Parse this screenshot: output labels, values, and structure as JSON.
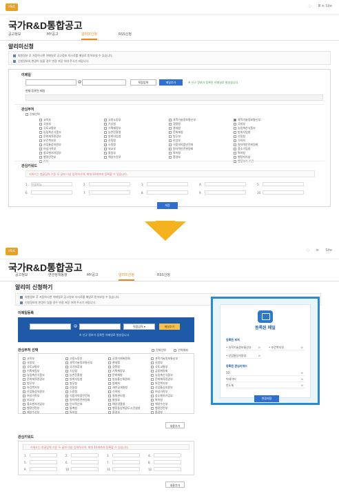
{
  "top": {
    "header": {
      "logo": "r&d",
      "icons": [
        "circle-icon",
        "hamburger-icon"
      ],
      "links": [
        "",
        "Ⅲ ≡ Site"
      ]
    },
    "page_title": "국가R&D통합공고",
    "tabs": [
      {
        "label": "공고정보",
        "active": false
      },
      {
        "label": "MY공고",
        "active": false
      },
      {
        "label": "알리미신청",
        "active": true
      },
      {
        "label": "RSS신청",
        "active": false
      }
    ],
    "section_title": "알리미신청",
    "notes": [
      "회원정보 후 저장하시면 이메일로 공고정보 자시로를 메일로 받아보실 수 있습니다.",
      "신청정보의 변경이 있을 경우 변경 저장 하여 주시기 바랍니다."
    ],
    "email": {
      "label": "이메일",
      "at": "@",
      "select_label": "직접입력",
      "add_button": "메일추가",
      "hint": "※ 신규 정보가 등록된 이메일로 발송됩니다.",
      "registered_label": "현재 등록된 메일"
    },
    "dept": {
      "label": "관심부처",
      "select_all": "전체선택",
      "columns": [
        [
          "교육부",
          "국방부",
          "국토교통부",
          "농림축산식품부",
          "문화체육관광부",
          "보건복지부",
          "산업통상자원부",
          "여성가족부",
          "중소벤처기업부",
          "행정안전부",
          "기타"
        ],
        [
          "고용노동부",
          "기상청",
          "기획재정부",
          "농촌진흥청",
          "방위사업청",
          "산림청",
          "소방청",
          "외교부",
          "통일부",
          "해양수산부"
        ],
        [
          "과학기술정보통신부",
          "경찰청",
          "관세청",
          "문화재청",
          "법무부",
          "산업부",
          "식품의약품안전처",
          "원자력안전위원회",
          "특허청",
          "환경부"
        ],
        [
          "과학기술정보통신부",
          "국방부",
          "농림축산식품부",
          "방위사업청",
          "산림청",
          "식약처",
          "원자력안전위원회",
          "중소기업청",
          "특허청",
          "행정자치부",
          "행정부처 기관"
        ]
      ],
      "checked": [
        [
          3,
          0
        ]
      ]
    },
    "keyword": {
      "label": "관심키워드",
      "note": "키워드는 한글입력 기준 두 글자 이상 입력하시며, 최대 10개까지 등록할 수 있습니다.",
      "labels": [
        "1.",
        "2.",
        "3.",
        "4.",
        "5.",
        "6.",
        "7.",
        "8.",
        "9.",
        "10."
      ],
      "first_value": "인공지능"
    },
    "save_button": "저장"
  },
  "bottom": {
    "header": {
      "logo": "r&d",
      "right": "Site"
    },
    "page_title": "국가R&D통합공고",
    "tabs": [
      {
        "label": "공고정보",
        "active": false
      },
      {
        "label": "연관정책동향",
        "active": false
      },
      {
        "label": "MY공고",
        "active": false
      },
      {
        "label": "알리미신청",
        "active": true
      },
      {
        "label": "RSS신청",
        "active": false
      }
    ],
    "section_title": "알리미 신청하기",
    "notes": [
      "회원정보 후 저장하시면 이메일로 공고정보 자시로를 메일로 받아보실 수 있습니다.",
      "신청정보의 변경이 있을 경우 변경 저장 하여 주시기 바랍니다."
    ],
    "email": {
      "label": "이메일등록",
      "at": "@",
      "select_label": "직접입력",
      "add_button": "메일추가",
      "hint": "※ 신규 정보가 등록된 이메일로 발송됩니다."
    },
    "dept": {
      "label": "관심부처 선택",
      "select_all": "전체선택",
      "deselect_all": "선택해제",
      "columns": [
        [
          "교육부",
          "국방부",
          "국토교통부",
          "기획재정부",
          "농림축산식품부",
          "문화체육관광부",
          "법무부",
          "보건복지부",
          "산업통상자원부",
          "여성가족부",
          "외교부",
          "중소벤처기업부",
          "행정안전부",
          "해양수산부"
        ],
        [
          "고용노동부",
          "과학기술정보통신부",
          "국가보훈처",
          "기상청",
          "농촌진흥청",
          "방위사업청",
          "병무청",
          "산림청",
          "소방청",
          "식품의약품안전처",
          "원자력안전위원회",
          "인사혁신처",
          "통계청",
          "특허청"
        ],
        [
          "공정거래위원회",
          "관세청",
          "경찰청",
          "기획재정부",
          "문화재청",
          "방송통신위원회",
          "법제처",
          "새만금개발청",
          "식약처",
          "질병관리청",
          "통일부",
          "해양경찰청",
          "행정중심복합도시건설청",
          "환경부"
        ],
        [
          "과학기술정보통신부",
          "국방부",
          "국토교통부",
          "금융위원회",
          "농림축산식품부",
          "문화체육관광부",
          "보건복지부",
          "산업통상자원부",
          "여성가족부",
          "중소벤처기업부",
          "특허청",
          "해양수산부",
          "행정안전부",
          "환경부"
        ]
      ],
      "add_button": "내용추가"
    },
    "keyword": {
      "label": "관심키워드",
      "note": "키워드는 한글입력 기준 두 글자 이상 입력하시며, 최대 10개까지 등록할 수 있습니다.",
      "labels": [
        "1.",
        "2.",
        "3.",
        "4.",
        "5.",
        "6.",
        "7.",
        "8.",
        "9.",
        "10.",
        "11.",
        "12."
      ],
      "add_button": "내용추가"
    },
    "registered": {
      "title": "등록된 메일",
      "dept_title": "등록된 부처",
      "depts": [
        "과학기술정보통신부",
        "보건복지부",
        "산업통상자원부"
      ],
      "kw_title": "등록된 관심키워드",
      "keywords": [
        "5G",
        "빅데이터",
        "반도체"
      ],
      "save_button": "변경저장"
    }
  }
}
